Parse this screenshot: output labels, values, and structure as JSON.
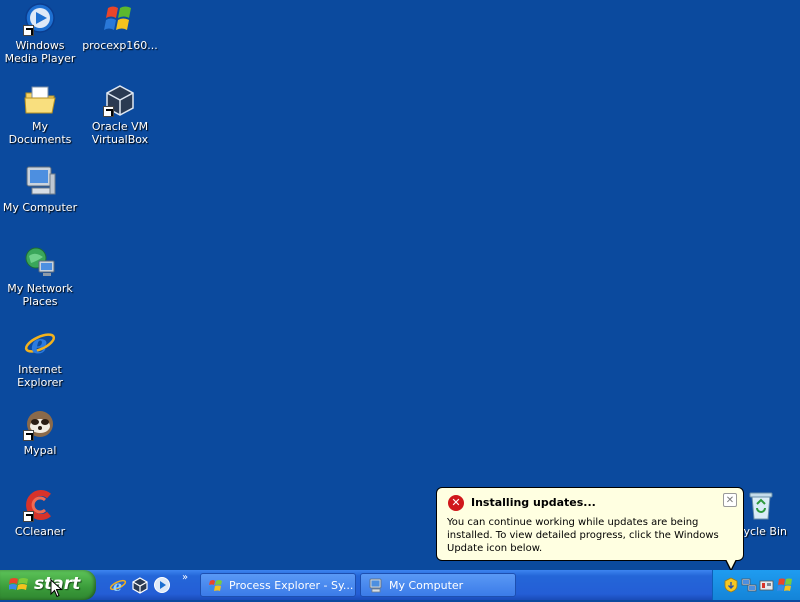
{
  "desktop": {
    "icons": [
      {
        "label": "Windows Media Player",
        "icon": "media-player-icon",
        "shortcut": true
      },
      {
        "label": "procexp160...",
        "icon": "process-explorer-icon",
        "shortcut": false
      },
      {
        "label": "My Documents",
        "icon": "documents-folder-icon",
        "shortcut": false
      },
      {
        "label": "Oracle VM VirtualBox",
        "icon": "virtualbox-icon",
        "shortcut": true
      },
      {
        "label": "My Computer",
        "icon": "computer-icon",
        "shortcut": false
      },
      {
        "label": "My Network Places",
        "icon": "network-places-icon",
        "shortcut": false
      },
      {
        "label": "Internet Explorer",
        "icon": "internet-explorer-icon",
        "shortcut": false
      },
      {
        "label": "Mypal",
        "icon": "mypal-icon",
        "shortcut": true
      },
      {
        "label": "CCleaner",
        "icon": "ccleaner-icon",
        "shortcut": true
      },
      {
        "label": "cycle Bin",
        "icon": "recycle-bin-icon",
        "shortcut": false
      }
    ]
  },
  "balloon": {
    "icon": "error-icon",
    "title": "Installing updates...",
    "body": "You can continue working while updates are being installed. To view detailed progress, click the Windows Update icon below.",
    "close_icon": "close-icon"
  },
  "taskbar": {
    "start_label": "start",
    "quick_launch": [
      "internet-explorer-icon",
      "virtualbox-icon",
      "media-player-icon"
    ],
    "overflow_chevron": "»",
    "tasks": [
      {
        "label": "Process Explorer - Sy...",
        "icon": "process-explorer-icon"
      },
      {
        "label": "My Computer",
        "icon": "computer-icon"
      }
    ],
    "tray_icons": [
      "windows-update-icon",
      "network-icon",
      "safely-remove-hardware-icon",
      "security-center-icon"
    ]
  },
  "colors": {
    "desktop_background": "#0b4a9e",
    "balloon_background": "#ffffe1",
    "start_button": "#3a9b3a",
    "taskbar": "#245ed6",
    "tray": "#1484d8"
  }
}
